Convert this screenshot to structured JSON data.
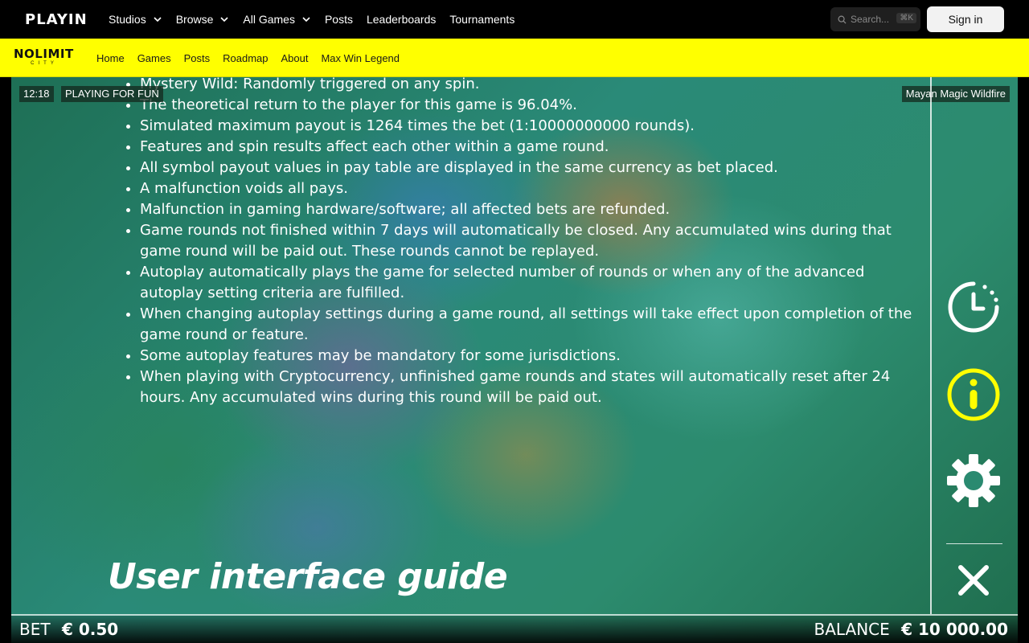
{
  "site": {
    "logo": "PLAYIN",
    "nav": [
      {
        "label": "Studios",
        "dropdown": true
      },
      {
        "label": "Browse",
        "dropdown": true
      },
      {
        "label": "All Games",
        "dropdown": true
      },
      {
        "label": "Posts",
        "dropdown": false
      },
      {
        "label": "Leaderboards",
        "dropdown": false
      },
      {
        "label": "Tournaments",
        "dropdown": false
      }
    ],
    "search_placeholder": "Search...",
    "search_shortcut": "⌘K",
    "signin_label": "Sign in"
  },
  "studio": {
    "logo_main": "NOLIMIT",
    "logo_sub": "CITY",
    "nav": [
      "Home",
      "Games",
      "Posts",
      "Roadmap",
      "About",
      "Max Win Legend"
    ],
    "accent": "#ffff00"
  },
  "game": {
    "clock": "12:18",
    "mode": "PLAYING FOR FUN",
    "title": "Mayan Magic Wildfire",
    "rules": [
      "Mystery Wild: Randomly triggered on any spin.",
      "The theoretical return to the player for this game is 96.04%.",
      "Simulated maximum payout is 1264 times the bet (1:10000000000 rounds).",
      "Features and spin results affect each other within a game round.",
      "All symbol payout values in pay table are displayed in the same currency as bet placed.",
      "A malfunction voids all pays.",
      "Malfunction in gaming hardware/software; all affected bets are refunded.",
      "Game rounds not finished within 7 days will automatically be closed. Any accumulated wins during that game round will be paid out. These rounds cannot be replayed.",
      "Autoplay automatically plays the game for selected number of rounds or when any of the advanced autoplay setting criteria are fulfilled.",
      "When changing autoplay settings during a game round, all settings will take effect upon completion of the game round or feature.",
      "Some autoplay features may be mandatory for some jurisdictions.",
      "When playing with Cryptocurrency, unfinished game rounds and states will automatically reset after 24 hours. Any accumulated wins during this round will be paid out."
    ],
    "section_title": "User interface guide",
    "side_icons": [
      "history-icon",
      "info-icon",
      "settings-gear-icon",
      "close-icon"
    ],
    "bet_label": "BET",
    "bet_value": "€ 0.50",
    "balance_label": "BALANCE",
    "balance_value": "€ 10 000.00",
    "info_color": "#ffff00"
  }
}
